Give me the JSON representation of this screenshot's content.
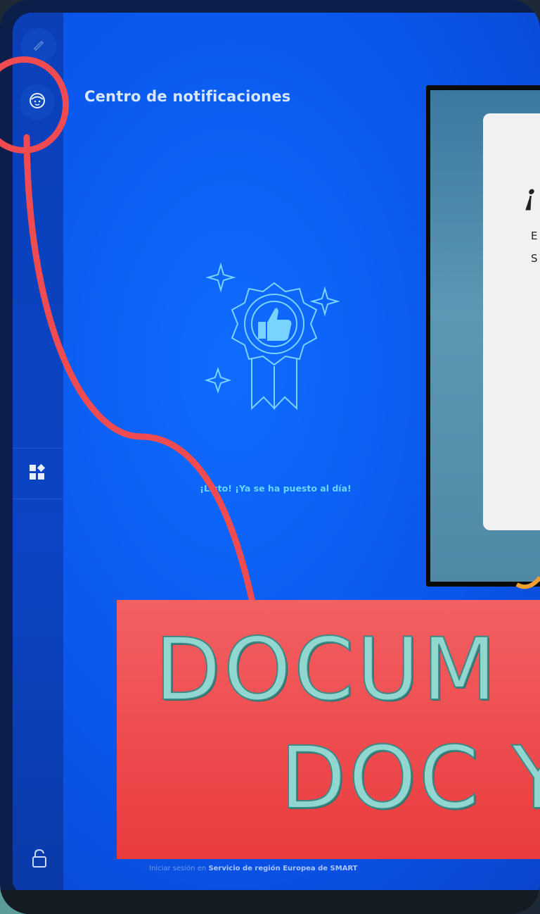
{
  "screen": {
    "title": "Centro de notificaciones",
    "empty_message": "¡Listo! ¡Ya se ha puesto al día!",
    "signin_prefix": "Iniciar sesión en",
    "signin_service": "Servicio de región Europea de SMART"
  },
  "inset": {
    "heading": "¡",
    "line1": "E",
    "line2": "S"
  },
  "banner": {
    "line1": "DOCUM",
    "line2": "DOC Y"
  },
  "colors": {
    "accent": "#ef4b51",
    "screen_blue": "#0a56ec",
    "banner_text": "#92d6d0"
  },
  "icons": {
    "top": "edit-icon",
    "profile": "profile-face-icon",
    "widgets": "widgets-icon",
    "lock": "unlock-icon",
    "badge": "thumbs-up-award-icon"
  }
}
